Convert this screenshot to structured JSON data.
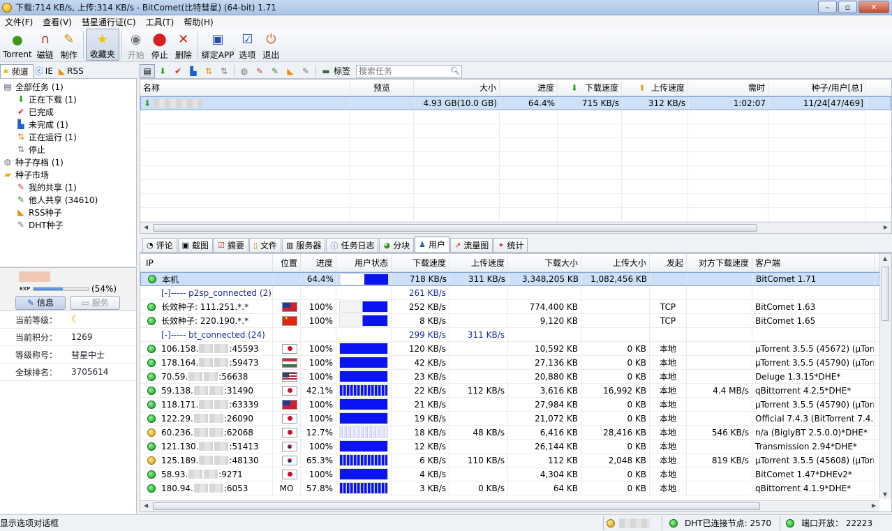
{
  "window": {
    "title": "下载:714 KB/s, 上传:314 KB/s - BitComet(比特彗星) (64-bit) 1.71",
    "minimize": "–",
    "maximize": "▫",
    "close": "✕"
  },
  "menu": [
    "文件(F)",
    "查看(V)",
    "彗星通行证(C)",
    "工具(T)",
    "帮助(H)"
  ],
  "toolbar": {
    "torrent": "Torrent",
    "magnet": "磁链",
    "make": "制作",
    "favorites": "收藏夹",
    "start": "开始",
    "stop": "停止",
    "delete": "删除",
    "bind_app": "綁定APP",
    "options": "选项",
    "exit": "退出"
  },
  "left_tabs": {
    "channels": "频道",
    "ie": "IE",
    "rss": "RSS"
  },
  "tree": {
    "all": "全部任务 (1)",
    "downloading": "正在下载 (1)",
    "completed": "已完成",
    "incomplete": "未完成 (1)",
    "running": "正在运行 (1)",
    "stopped": "停止",
    "archive": "种子存档 (1)",
    "market": "种子市场",
    "my_share": "我的共享 (1)",
    "others_share": "他人共享 (34610)",
    "rss_seeds": "RSS种子",
    "dht_seeds": "DHT种子"
  },
  "profile": {
    "exp_label": "EXP",
    "exp_fraction": 0.54,
    "exp_percent": "(54%)",
    "tab_info": "信息",
    "tab_service": "服务",
    "level_label": "当前等级：",
    "level_icon": "☾",
    "points_label": "当前积分：",
    "points_value": "1269",
    "rank_title_label": "等级称号：",
    "rank_title_value": "彗星中士",
    "global_rank_label": "全球排名：",
    "global_rank_value": "3705614"
  },
  "task_toolbar": {
    "tag": "标签",
    "search_placeholder": "搜索任务"
  },
  "tasks": {
    "columns": {
      "name": "名称",
      "preview": "预览",
      "size": "大小",
      "progress": "进度",
      "down": "下载速度",
      "up": "上传速度",
      "eta": "需时",
      "seeds": "种子/用户[总]"
    },
    "rows": [
      {
        "size": "4.93 GB(10.0 GB)",
        "progress": "64.4%",
        "down": "715 KB/s",
        "up": "312 KB/s",
        "eta": "1:02:07",
        "seeds": "11/24[47/469]"
      }
    ]
  },
  "bottom_tabs": {
    "comments": "评论",
    "screenshots": "截图",
    "summary": "摘要",
    "files": "文件",
    "servers": "服务器",
    "log": "任务日志",
    "pieces": "分块",
    "peers": "用户",
    "traffic": "流量图",
    "stats": "统计"
  },
  "peers": {
    "columns": {
      "ip": "IP",
      "location": "位置",
      "progress": "进度",
      "state": "用户状态",
      "down": "下载速度",
      "up": "上传速度",
      "downloaded": "下载大小",
      "uploaded": "上传大小",
      "initiator": "发起",
      "remote_down": "对方下载速度",
      "client": "客户端"
    },
    "rows": [
      {
        "ip": "本机",
        "loc": "",
        "prog": "64.4%",
        "down": "718 KB/s",
        "up": "311 KB/s",
        "dsize": "3,348,205 KB",
        "usize": "1,082,456 KB",
        "init": "",
        "rdown": "",
        "client": "BitComet 1.71"
      },
      {
        "ip": "[-]----- p2sp_connected (2)",
        "loc": "",
        "prog": "",
        "down": "261 KB/s",
        "up": "",
        "dsize": "",
        "usize": "",
        "init": "",
        "rdown": "",
        "client": ""
      },
      {
        "ip": "长效种子: 111.251.*.*",
        "loc": "",
        "prog": "100%",
        "down": "252 KB/s",
        "up": "",
        "dsize": "774,400 KB",
        "usize": "",
        "init": "TCP",
        "rdown": "",
        "client": "BitComet 1.63"
      },
      {
        "ip": "长效种子: 220.190.*.*",
        "loc": "",
        "prog": "100%",
        "down": "8 KB/s",
        "up": "",
        "dsize": "9,120 KB",
        "usize": "",
        "init": "TCP",
        "rdown": "",
        "client": "BitComet 1.65"
      },
      {
        "ip": "[-]----- bt_connected (24)",
        "loc": "",
        "prog": "",
        "down": "299 KB/s",
        "up": "311 KB/s",
        "dsize": "",
        "usize": "",
        "init": "",
        "rdown": "",
        "client": ""
      },
      {
        "ip": "106.158.",
        "ip_tail": ":45593",
        "loc": "",
        "prog": "100%",
        "down": "120 KB/s",
        "up": "",
        "dsize": "10,592 KB",
        "usize": "0 KB",
        "init": "本地",
        "rdown": "",
        "client": "µTorrent 3.5.5 (45672) (µTorrent"
      },
      {
        "ip": "178.164.",
        "ip_tail": ":59473",
        "loc": "",
        "prog": "100%",
        "down": "42 KB/s",
        "up": "",
        "dsize": "27,136 KB",
        "usize": "0 KB",
        "init": "本地",
        "rdown": "",
        "client": "µTorrent 3.5.5 (45790) (µTorrent"
      },
      {
        "ip": "70.59.",
        "ip_tail": ":56638",
        "loc": "",
        "prog": "100%",
        "down": "23 KB/s",
        "up": "",
        "dsize": "20,880 KB",
        "usize": "0 KB",
        "init": "本地",
        "rdown": "",
        "client": "Deluge 1.3.15*DHE*"
      },
      {
        "ip": "59.138.",
        "ip_tail": ":31490",
        "loc": "",
        "prog": "42.1%",
        "down": "22 KB/s",
        "up": "112 KB/s",
        "dsize": "3,616 KB",
        "usize": "16,992 KB",
        "init": "本地",
        "rdown": "4.4 MB/s",
        "client": "qBittorrent 4.2.5*DHE*"
      },
      {
        "ip": "118.171.",
        "ip_tail": ":63339",
        "loc": "",
        "prog": "100%",
        "down": "21 KB/s",
        "up": "",
        "dsize": "27,984 KB",
        "usize": "0 KB",
        "init": "本地",
        "rdown": "",
        "client": "µTorrent 3.5.5 (45790) (µTorrent"
      },
      {
        "ip": "122.29.",
        "ip_tail": ":26090",
        "loc": "",
        "prog": "100%",
        "down": "19 KB/s",
        "up": "",
        "dsize": "21,072 KB",
        "usize": "0 KB",
        "init": "本地",
        "rdown": "",
        "client": "Official 7.4.3 (BitTorrent 7.4.3)*"
      },
      {
        "ip": "60.236.",
        "ip_tail": ":62068",
        "loc": "",
        "prog": "12.7%",
        "down": "18 KB/s",
        "up": "48 KB/s",
        "dsize": "6,416 KB",
        "usize": "28,416 KB",
        "init": "本地",
        "rdown": "546 KB/s",
        "client": "n/a (BiglyBT 2.5.0.0)*DHE*"
      },
      {
        "ip": "121.130.",
        "ip_tail": ":51413",
        "loc": "",
        "prog": "100%",
        "down": "12 KB/s",
        "up": "",
        "dsize": "26,144 KB",
        "usize": "0 KB",
        "init": "本地",
        "rdown": "",
        "client": "Transmission 2.94*DHE*"
      },
      {
        "ip": "125.189.",
        "ip_tail": ":48130",
        "loc": "",
        "prog": "65.3%",
        "down": "6 KB/s",
        "up": "110 KB/s",
        "dsize": "112 KB",
        "usize": "2,048 KB",
        "init": "本地",
        "rdown": "819 KB/s",
        "client": "µTorrent 3.5.5 (45608) (µTorrent"
      },
      {
        "ip": "58.93.",
        "ip_tail": ":9271",
        "loc": "",
        "prog": "100%",
        "down": "4 KB/s",
        "up": "",
        "dsize": "4,304 KB",
        "usize": "0 KB",
        "init": "本地",
        "rdown": "",
        "client": "BitComet 1.47*DHEv2*"
      },
      {
        "ip": "180.94.",
        "ip_tail": ":6053",
        "loc": "MO",
        "prog": "57.8%",
        "down": "3 KB/s",
        "up": "0 KB/s",
        "dsize": "64 KB",
        "usize": "0 KB",
        "init": "本地",
        "rdown": "",
        "client": "qBittorrent 4.1.9*DHE*"
      }
    ]
  },
  "statusbar": {
    "hint": "显示选项对话框",
    "dht_label": "DHT已连接节点:",
    "dht_value": "2570",
    "port_label": "端口开放：",
    "port_value": "22223"
  },
  "colors": {
    "accent": "#0a14f0",
    "selection": "#cde0f7",
    "online": "#0c9c1c"
  }
}
